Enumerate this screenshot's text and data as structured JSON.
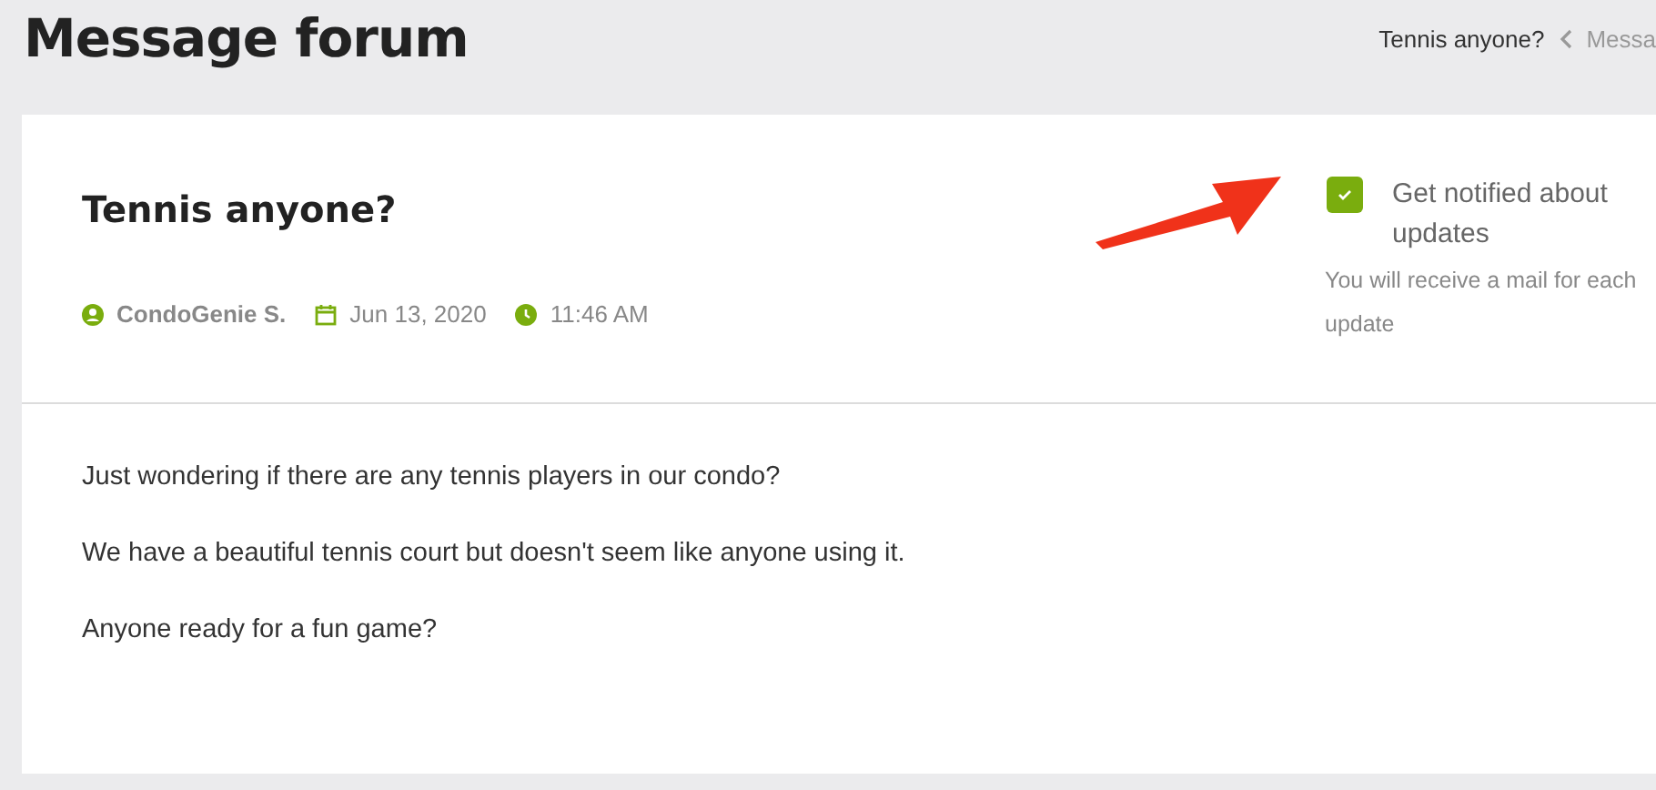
{
  "page_title": "Message forum",
  "breadcrumb": [
    {
      "label": "Tennis anyone?"
    },
    {
      "label": "Messa"
    }
  ],
  "post": {
    "title": "Tennis anyone?",
    "author": "CondoGenie S.",
    "date": "Jun 13, 2020",
    "time": "11:46 AM",
    "notify": {
      "label": "Get notified about updates",
      "checked": true,
      "hint": "You will receive a mail for each update"
    },
    "body": [
      "Just wondering if there are any tennis players in our condo?",
      "We have a beautiful tennis court but doesn't seem like anyone using it.",
      "Anyone ready for a fun game?"
    ]
  }
}
